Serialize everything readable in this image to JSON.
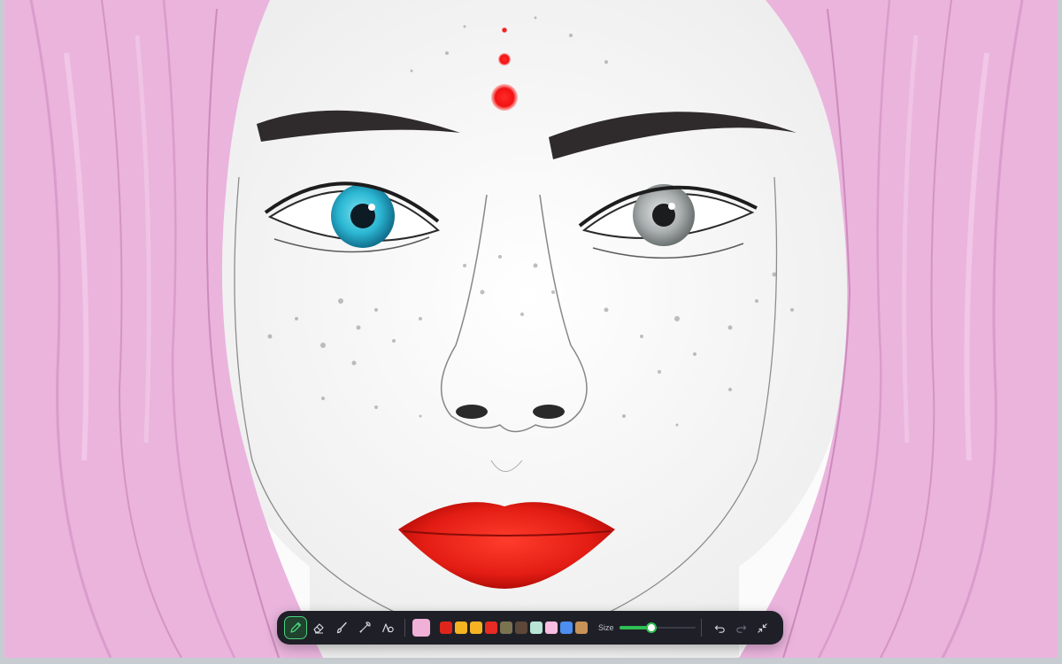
{
  "app": {
    "canvas_subject": "pencil-sketch-portrait"
  },
  "toolbar": {
    "tools": [
      {
        "name": "pencil",
        "icon": "pencil-icon",
        "active": true
      },
      {
        "name": "eraser",
        "icon": "eraser-icon",
        "active": false
      },
      {
        "name": "brush",
        "icon": "brush-icon",
        "active": false
      },
      {
        "name": "eyedropper",
        "icon": "eyedropper-icon",
        "active": false
      },
      {
        "name": "shapes",
        "icon": "shapes-icon",
        "active": false
      }
    ],
    "current_color": "#f0b0d8",
    "palette": [
      "#e0261c",
      "#f4b321",
      "#f5b324",
      "#e82b23",
      "#7b7350",
      "#5c4739",
      "#b9e5d6",
      "#f8bde3",
      "#4d8ef0",
      "#c79358"
    ],
    "size_label": "Size",
    "size_value": 0.42,
    "accent_color": "#2fbf55",
    "actions": [
      {
        "name": "undo",
        "icon": "undo-icon",
        "enabled": true
      },
      {
        "name": "redo",
        "icon": "redo-icon",
        "enabled": false
      },
      {
        "name": "collapse",
        "icon": "collapse-icon",
        "enabled": true
      }
    ]
  }
}
